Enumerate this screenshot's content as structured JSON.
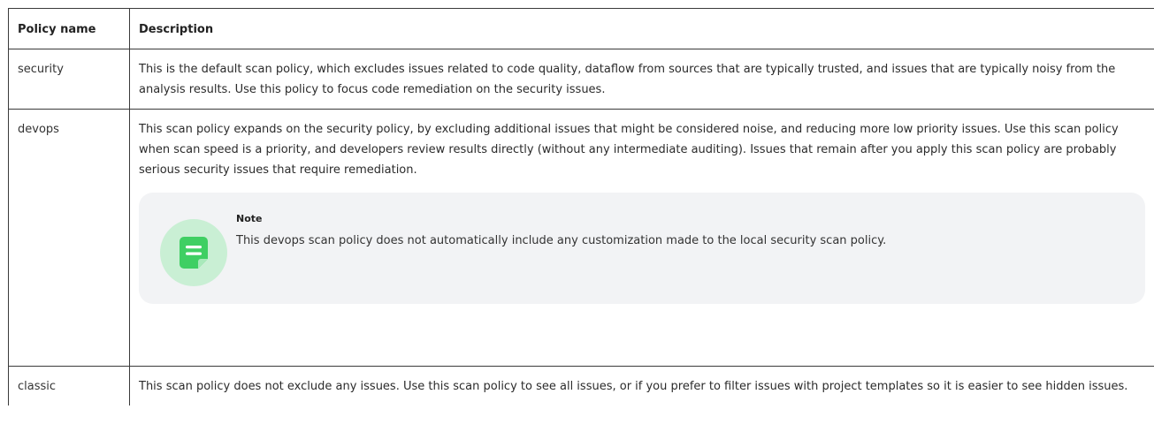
{
  "table": {
    "headers": {
      "name": "Policy name",
      "description": "Description"
    },
    "rows": [
      {
        "name": "security",
        "description": "This is the default scan policy, which excludes issues related to code quality, dataflow from sources that are typically trusted, and issues that are typically noisy from the analysis results. Use this policy to focus code remediation on the security issues."
      },
      {
        "name": "devops",
        "description": "This scan policy expands on the security policy, by excluding additional issues that might be considered noise, and reducing more low priority issues. Use this scan policy when scan speed is a priority, and developers review results directly (without any intermediate auditing). Issues that remain after you apply this scan policy are probably serious security issues that require remediation.",
        "note": {
          "title": "Note",
          "text": "This devops scan policy does not automatically include any customization made to the local security scan policy.",
          "icon": "note-icon"
        }
      },
      {
        "name": "classic",
        "description": "This scan policy does not exclude any issues. Use this scan policy to see all issues, or if you prefer to filter issues with project templates so it is easier to see hidden issues."
      }
    ]
  },
  "colors": {
    "note_background": "#f2f3f5",
    "note_icon_circle": "#c9efd4",
    "note_icon_fill": "#3fcf63"
  }
}
